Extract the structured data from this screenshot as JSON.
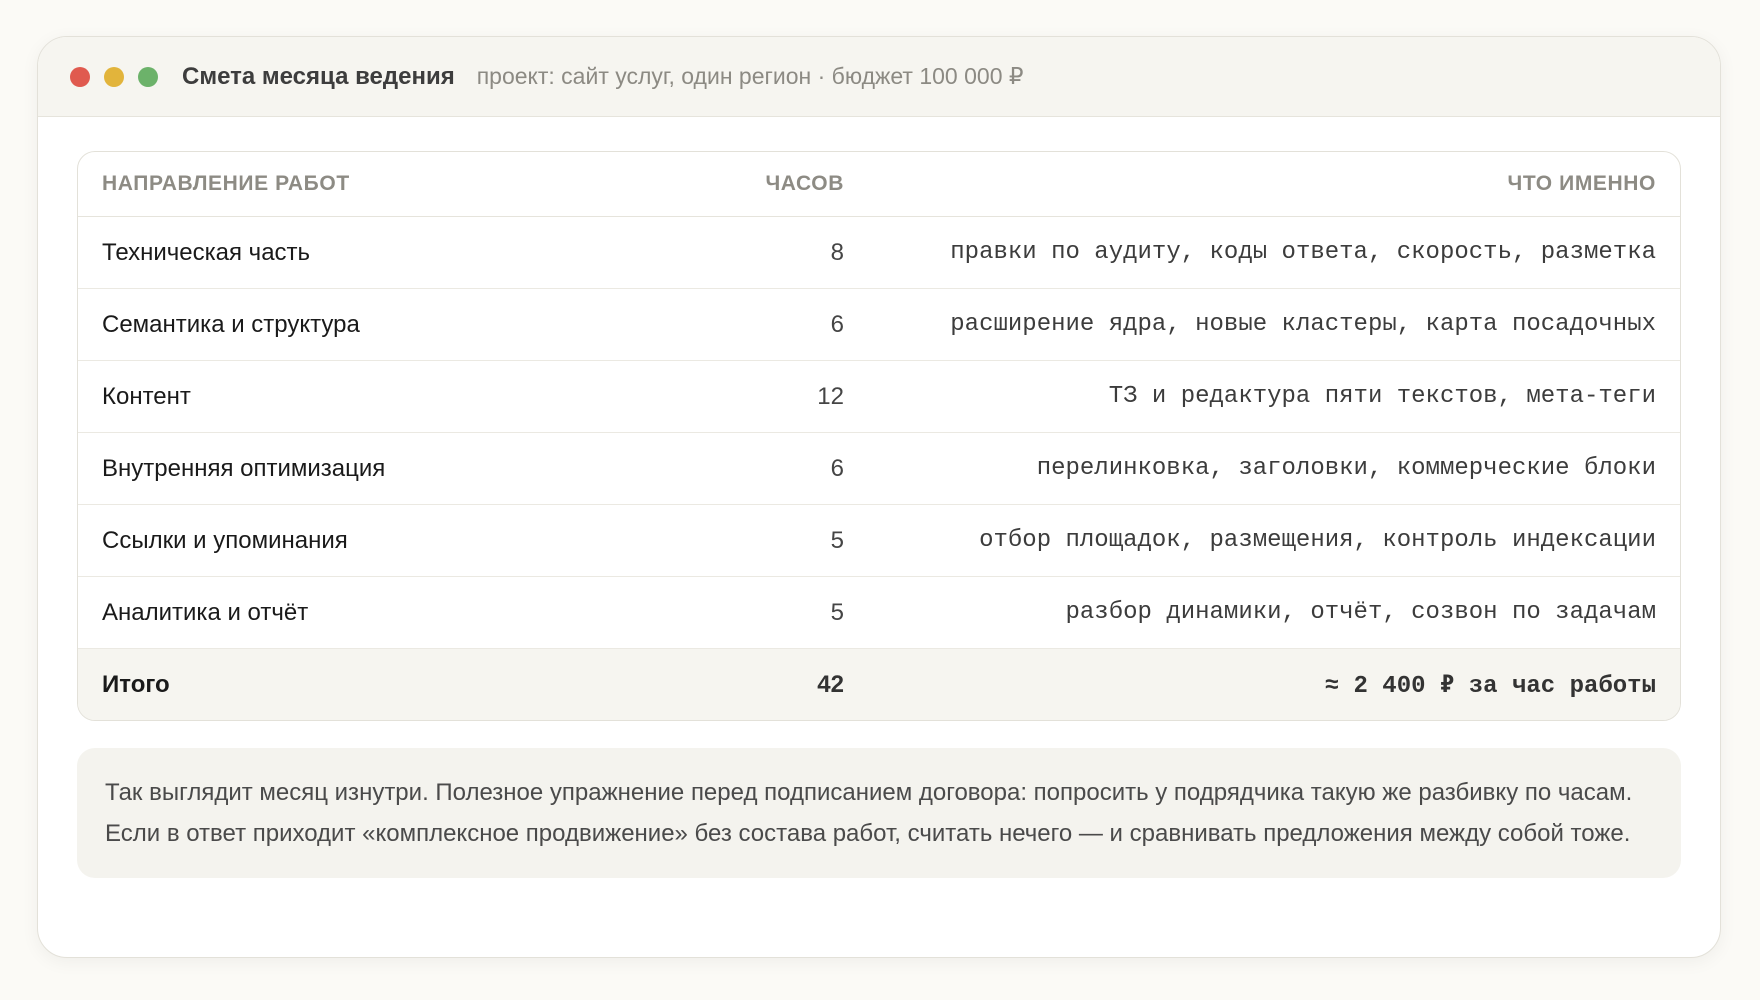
{
  "window": {
    "title": "Смета месяца ведения",
    "subtitle": "проект: сайт услуг, один регион · бюджет 100 000 ₽"
  },
  "table": {
    "headers": {
      "direction": "Направление работ",
      "hours": "Часов",
      "details": "Что именно"
    },
    "rows": [
      {
        "direction": "Техническая часть",
        "hours": "8",
        "details": "правки по аудиту, коды ответа, скорость, разметка"
      },
      {
        "direction": "Семантика и структура",
        "hours": "6",
        "details": "расширение ядра, новые кластеры, карта посадочных"
      },
      {
        "direction": "Контент",
        "hours": "12",
        "details": "ТЗ и редактура пяти текстов, мета-теги"
      },
      {
        "direction": "Внутренняя оптимизация",
        "hours": "6",
        "details": "перелинковка, заголовки, коммерческие блоки"
      },
      {
        "direction": "Ссылки и упоминания",
        "hours": "5",
        "details": "отбор площадок, размещения, контроль индексации"
      },
      {
        "direction": "Аналитика и отчёт",
        "hours": "5",
        "details": "разбор динамики, отчёт, созвон по задачам"
      }
    ],
    "total": {
      "label": "Итого",
      "hours": "42",
      "details": "≈ 2 400 ₽ за час работы"
    }
  },
  "note": "Так выглядит месяц изнутри. Полезное упражнение перед подписанием договора: попросить у подрядчика такую же разбивку по часам. Если в ответ приходит «комплексное продвижение» без состава работ, считать нечего — и сравнивать предложения между собой тоже.",
  "colors": {
    "dot_red": "#e05a4f",
    "dot_yellow": "#e2b43b",
    "dot_green": "#6cb26a"
  }
}
